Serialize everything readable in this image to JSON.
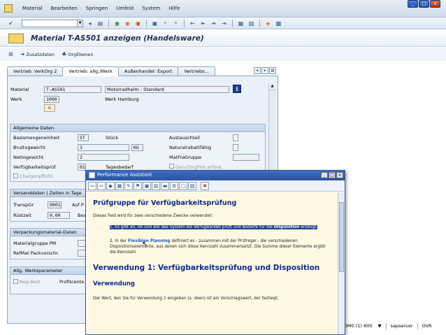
{
  "menubar": {
    "items": [
      {
        "label": "Material",
        "key": "M"
      },
      {
        "label": "Bearbeiten",
        "key": "B"
      },
      {
        "label": "Springen",
        "key": "S"
      },
      {
        "label": "Umfeld",
        "key": "U"
      },
      {
        "label": "System",
        "key": "y"
      },
      {
        "label": "Hilfe",
        "key": "H"
      }
    ]
  },
  "window_controls": {
    "minimize": "_",
    "maximize": "□",
    "close": "×"
  },
  "title": "Material T-AS501 anzeigen (Handelsware)",
  "app_toolbar": {
    "zusatzdaten": "Zusatzdaten",
    "orgebenen": "OrgEbenen"
  },
  "tabs": [
    {
      "label": "Vertrieb: VerkOrg 2",
      "active": false
    },
    {
      "label": "Vertrieb: allg./Werk",
      "active": true
    },
    {
      "label": "Außenhandel: Export",
      "active": false
    },
    {
      "label": "Vertriebs...",
      "active": false
    }
  ],
  "header_fields": {
    "material_label": "Material",
    "material_value": "T-AS501",
    "material_desc": "Motorradhelm - Standard",
    "werk_label": "Werk",
    "werk_value": "1000",
    "werk_desc": "Werk Hamburg",
    "info": "i"
  },
  "allgemeine_daten": {
    "title": "Allgemeine Daten",
    "basismengeneinheit_label": "Basismengeneinheit",
    "basismengeneinheit_value": "ST",
    "basismengeneinheit_desc": "Stück",
    "bruttogewicht_label": "Bruttogewicht",
    "bruttogewicht_value": "3",
    "gewicht_unit": "KG",
    "nettogewicht_label": "Nettogewicht",
    "nettogewicht_value": "2",
    "verfuegbarkeit_label": "Verfügbarkeitsprüf.",
    "verfuegbarkeit_value": "01",
    "verfuegbarkeit_desc": "Tagesbedarf",
    "chargenpflicht": "Chargenpflicht",
    "austauschteil": "Austauschteil",
    "naturalrabatt": "Naturalrabattfähig",
    "matfragruppe": "MatFraGruppe",
    "genchrg": "Gen.ChrgProt erford."
  },
  "versanddaten": {
    "title": "Versanddaten ( Zeiten in Tage",
    "transpgr_label": "TranspGr",
    "transpgr_value": "0001",
    "auf_label": "Auf P",
    "ruestzeit_label": "Rüstzeit",
    "ruestzeit_value": "0,00",
    "bea_label": "Bea"
  },
  "verpackung": {
    "title": "Verpackungsmaterial-Daten",
    "materialgruppe_label": "Materialgruppe PM",
    "refmat_label": "RefMat Packvorschr."
  },
  "werksparameter": {
    "title": "Allg. Werksparameter",
    "negbest": "Neg.Best.",
    "profitcenter": "Profitcente"
  },
  "statusbar": {
    "system": "DM0 (1) 800",
    "server": "sapserver",
    "mode": "OVR"
  },
  "performance_assistant": {
    "title": "Performance Assistant",
    "heading": "Prüfgruppe für Verfügbarkeitsprüfung",
    "intro": "Dieses Feld wird für zwei verschiedene Zwecke verwendet:",
    "item1_text": "1. Es gibt an, ob und wie das System die Verfügbarkeit prüft und Bedarfe für die ",
    "item1_bold": "Disposition",
    "item1_end": " erzeugt.",
    "item2_start": "2. In der ",
    "item2_link": "Flexiblen Planning",
    "item2_rest": " definiert es - zusammen mit der Prüfregel - die verschiedenen Dispositionselemente, aus denen sich diese Kennzahl zusammensetzt. Die Summe dieser Elemente ergibt die Kennzahl.",
    "heading2": "Verwendung 1: Verfügbarkeitsprüfung und Disposition",
    "heading3": "Verwendung",
    "para": "Der Wert, den Sie für Verwendung 1 eingeben (s. oben) ist ein Vorschlagswert, der festlegt,"
  }
}
